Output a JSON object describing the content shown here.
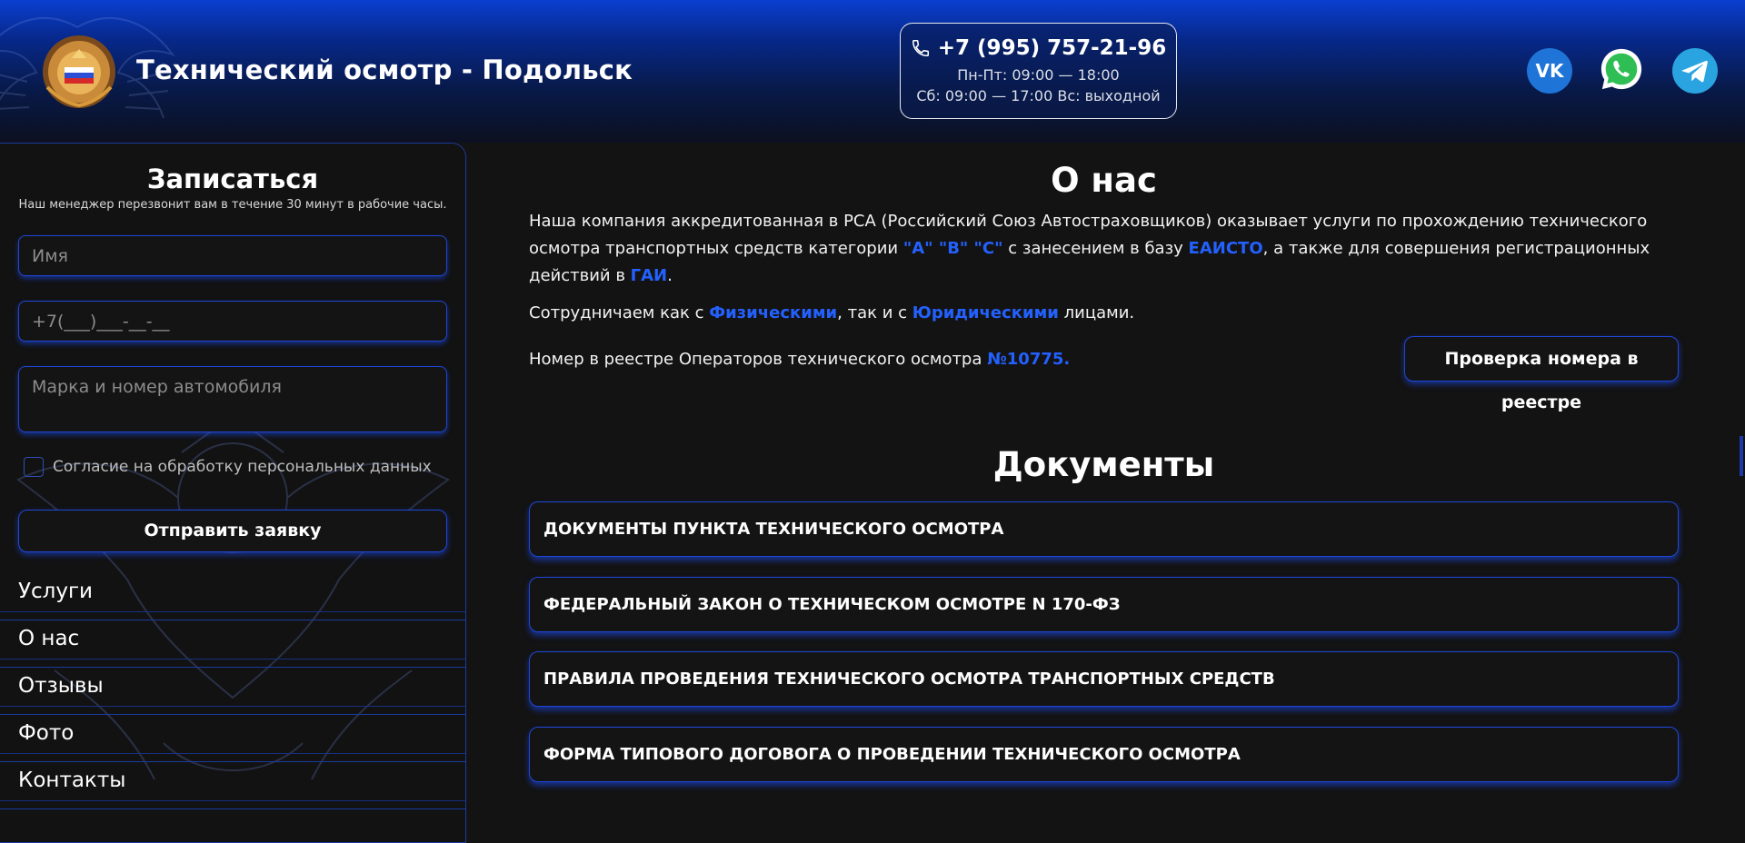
{
  "header": {
    "site_title": "Технический осмотр - Подольск",
    "phone": "+7 (995) 757-21-96",
    "hours_weekdays": "Пн-Пт: 09:00 — 18:00",
    "hours_weekend": "Сб: 09:00 — 17:00  Вс: выходной",
    "social": [
      "vk-icon",
      "whatsapp-icon",
      "telegram-icon"
    ]
  },
  "form": {
    "title": "Записаться",
    "subtitle": "Наш менеджер перезвонит вам в течение 30 минут в рабочие часы.",
    "name_placeholder": "Имя",
    "phone_placeholder": "+7(___)___-__-__",
    "car_placeholder": "Марка и номер автомобиля",
    "consent_label": "Согласие на обработку персональных данных",
    "submit_label": "Отправить заявку"
  },
  "nav": {
    "items": [
      "Услуги",
      "О нас",
      "Отзывы",
      "Фото",
      "Контакты"
    ]
  },
  "about": {
    "title": "О нас",
    "p1_a": "Наша компания аккредитованная в РСА (Российский Союз Автостраховщиков) оказывает услуги по прохождению технического осмотра транспортных средств категории ",
    "p1_cats": "\"А\" \"В\" \"С\"",
    "p1_b": " с занесением в базу ",
    "p1_eaisto": "ЕАИСТО",
    "p1_c": ", а также для совершения регистрационных действий в ",
    "p1_gai": "ГАИ",
    "p1_d": ".",
    "p2_a": "Сотрудничаем как с ",
    "p2_phys": "Физическими",
    "p2_b": ", так и с ",
    "p2_jur": "Юридическими",
    "p2_c": " лицами.",
    "p3_a": "Номер в реестре Операторов технического осмотра ",
    "p3_num": "№10775.",
    "verify_button": "Проверка номера в реестре"
  },
  "documents": {
    "title": "Документы",
    "items": [
      "ДОКУМЕНТЫ ПУНКТА ТЕХНИЧЕСКОГО ОСМОТРА",
      "ФЕДЕРАЛЬНЫЙ ЗАКОН О ТЕХНИЧЕСКОМ ОСМОТРЕ N 170-ФЗ",
      "ПРАВИЛА ПРОВЕДЕНИЯ ТЕХНИЧЕСКОГО ОСМОТРА ТРАНСПОРТНЫХ СРЕДСТВ",
      "ФОРМА ТИПОВОГО ДОГОВОГА О ПРОВЕДЕНИИ ТЕХНИЧЕСКОГО ОСМОТРА"
    ]
  },
  "colors": {
    "accent": "#1f47d6",
    "highlight": "#2361ff",
    "background": "#131313"
  }
}
